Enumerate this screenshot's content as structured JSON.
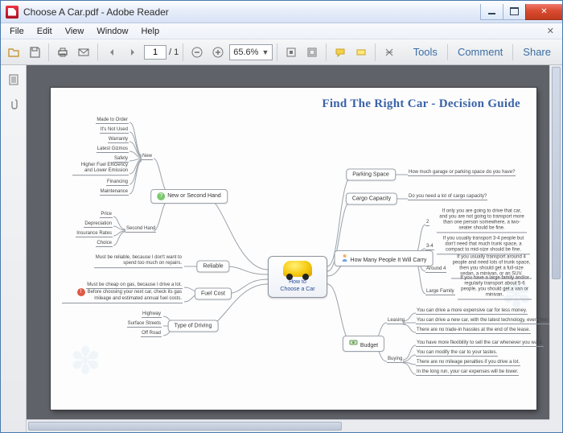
{
  "window": {
    "title": "Choose A Car.pdf - Adobe Reader"
  },
  "menu": [
    "File",
    "Edit",
    "View",
    "Window",
    "Help"
  ],
  "toolbar": {
    "page_current": "1",
    "page_total": "/ 1",
    "zoom": "65.6%"
  },
  "panels": {
    "tools": "Tools",
    "comment": "Comment",
    "share": "Share"
  },
  "doc": {
    "title": "Find The Right Car - Decision Guide",
    "center_line1": "How to",
    "center_line2": "Choose a Car",
    "main_left": {
      "newsecond": "New or Second Hand",
      "reliable": "Reliable",
      "fuelcost": "Fuel Cost",
      "typedrive": "Type of Driving",
      "new": "New",
      "secondhand": "Second Hand",
      "new_items": [
        "Made to Order",
        "It's Not Used",
        "Warranty",
        "Latest Gizmos",
        "Safety",
        "Higher Fuel Efficiency and Lower Emission",
        "Financing",
        "Maintenance"
      ],
      "second_items": [
        "Price",
        "Depreciation",
        "Insurance Rates",
        "Choice"
      ],
      "reliable_note": "Must be reliable, because I don't want to spend too much on repairs.",
      "fuel_note1": "Must be cheap on gas, because I drive a lot.",
      "fuel_note2": "Before choosing your next car, check its gas mileage and estimated annual fuel costs.",
      "drive_items": [
        "Highway",
        "Surface Streets",
        "Off Road"
      ]
    },
    "main_right": {
      "parking": "Parking Space",
      "parking_q": "How much garage or parking space do you have?",
      "cargo": "Cargo Capacity",
      "cargo_q": "Do you need a lot of cargo capacity?",
      "people": "How Many People It Will Carry",
      "people_rows": [
        {
          "k": "2",
          "v": "If only you are going to drive that car, and you are not going to transport more than one person somewhere, a two-seater should be fine."
        },
        {
          "k": "3-4",
          "v": "If you usually transport 3-4 people but don't need that much trunk space, a compact to mid-size should be fine."
        },
        {
          "k": "Around 4",
          "v": "If you usually transport around 4 people and need lots of trunk space, then you should get a full-size sedan, a minivan, or an SUV."
        },
        {
          "k": "Large Family",
          "v": "If you have a large family and/or regularly transport about 5-6 people, you should get a van or minivan."
        }
      ],
      "budget": "Budget",
      "budget_leasing": "Leasing",
      "budget_buying": "Buying",
      "leasing_items": [
        "You can drive a more expensive car for less money.",
        "You can drive a new car, with the latest technology, every few years.",
        "There are no trade-in hassles at the end of the lease."
      ],
      "buying_items": [
        "You have more flexibility to sell the car whenever you want.",
        "You can modify the car to your tastes.",
        "There are no mileage penalties if you drive a lot.",
        "In the long run, your car expenses will be lower."
      ]
    }
  }
}
